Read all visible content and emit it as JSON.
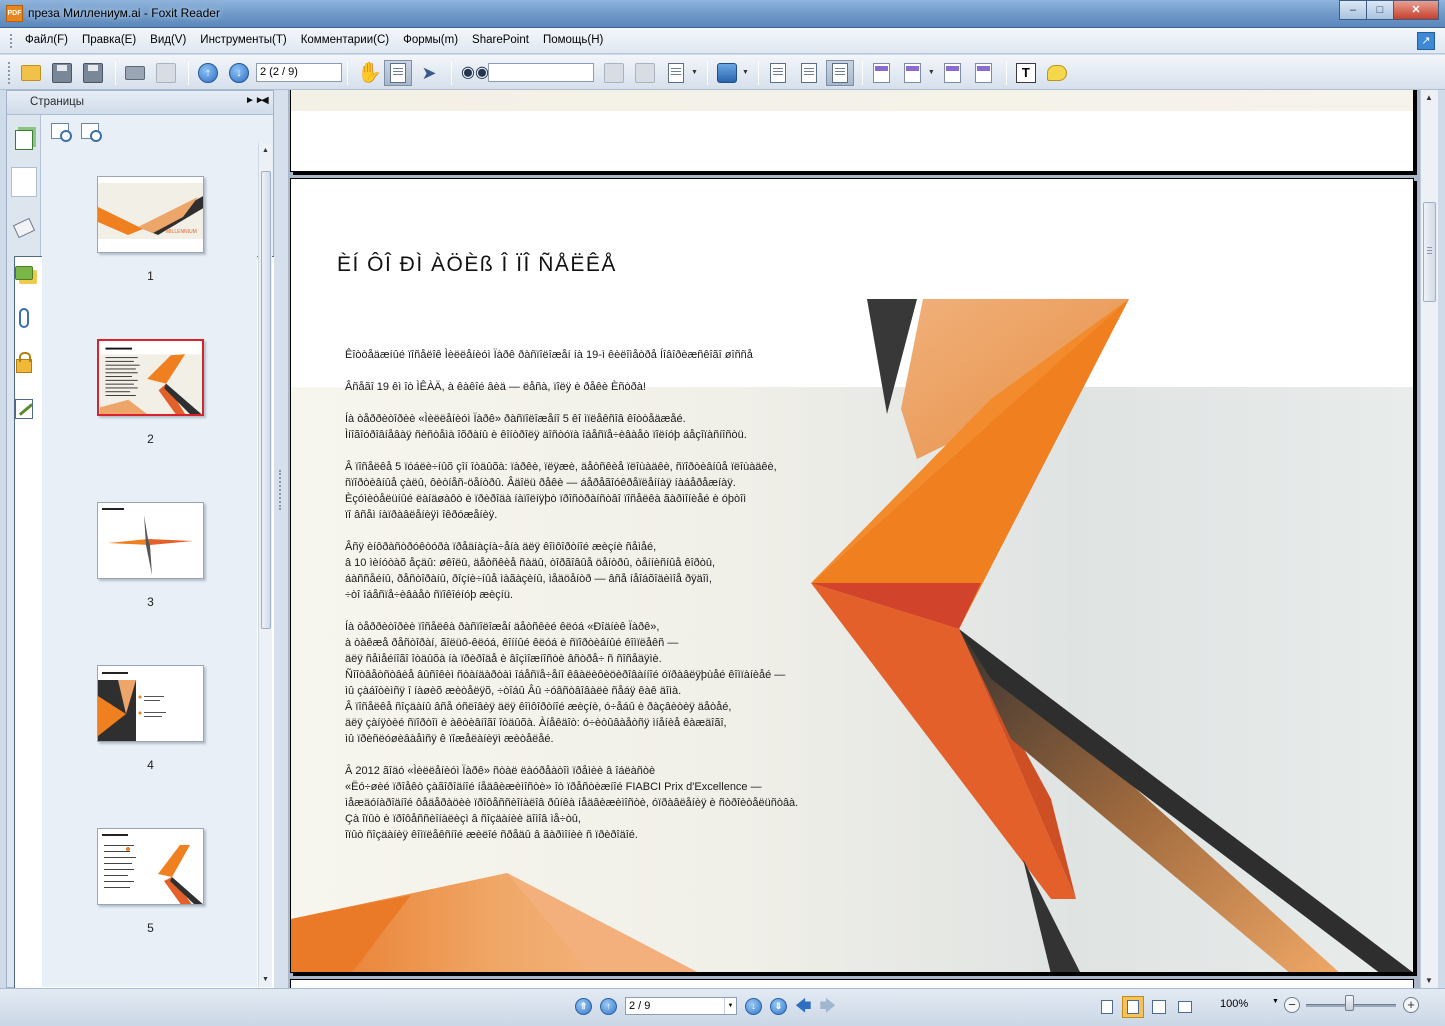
{
  "window": {
    "icon_label": "PDF",
    "title": "преза Миллениум.ai - Foxit Reader",
    "minimize_glyph": "–",
    "maximize_glyph": "□",
    "close_glyph": "✕"
  },
  "menu": {
    "items": [
      "Файл(F)",
      "Правка(E)",
      "Вид(V)",
      "Инструменты(T)",
      "Комментарии(C)",
      "Формы(m)",
      "SharePoint",
      "Помощь(H)"
    ]
  },
  "toolbar": {
    "page_field": "2 (2 / 9)",
    "search_value": ""
  },
  "left_panel": {
    "title": "Страницы",
    "thumbnails": [
      {
        "label": "1",
        "selected": false
      },
      {
        "label": "2",
        "selected": true
      },
      {
        "label": "3",
        "selected": false
      },
      {
        "label": "4",
        "selected": false
      },
      {
        "label": "5",
        "selected": false
      }
    ]
  },
  "document": {
    "page_title": "ÈÍ ÔÎ ÐÌ ÀÖÈß Î  ÏÎ ÑÅËÊÅ",
    "paragraphs": [
      [
        "Êîòòåäæíûé ïîñåëîê Ìèëëåíèóì  Ïàðê ðàñïîëîæåí íà 19-ì êèëîìåòðå Íîâîðèæñêîãî øîññå"
      ],
      [
        "Âñåãî 19 êì  îò  ÌÊÀÄ, à êàêîé âèä — ëåñà, ïîëÿ è ðåêè Èñòðà!"
      ],
      [
        "Íà òåððèòîðèè «Ìèëëåíèóì  Ïàðê» ðàñïîëîæåíî 5 êî  ìïëåêñîâ êîòòåäæåé.",
        "Ìíîãîóðîâíåâàÿ ñèñòåìà îõðàíû è êîíòðîëÿ äîñòóïà îáåñïå÷èâàåò ïîëíóþ áåçîïàñíîñòü."
      ],
      [
        "Â ïîñåëêå 5 ïóáëè÷íûõ çîí îòäûõà: ïàðêè, ïëÿæè, äåòñêèå ïëîùàäêè, ñïîðòèâíûå ïëîùàäêè,",
        "ñïîðòèâíûå çàëû, ôèòíåñ-öåíòðû. Âäîëü ðåêè — áåðåãîóêðåïëåííàÿ íàáåðåæíàÿ.",
        "Èçóìèòåëüíûé ëàíäøàôò è ïðèðîäà íàïîëíÿþò ïðîñòðàíñòâî ïîñåëêà ãàðìîíèåé è óþòîì",
        "ïî âñåì íàïðàâëåíèÿì îêðóæåíèÿ."
      ],
      [
        "Âñÿ èíôðàñòðóêòóðà ïðåäíàçíà÷åíà äëÿ êîìôîðòíîé æèçíè ñåìåé,",
        "â 10 ìèíóòàõ åçäû: øêîëû, äåòñêèå ñàäû, òîðãîâûå öåíòðû, òåííèñíûå êîðòû,",
        "áàññåéíû, ðåñòîðàíû, ðîçíè÷íûå ìàãàçèíû, ìåäöåíòð — âñå íåîáõîäèìîå ðÿäîì,",
        "÷òî îáåñïå÷èâàåò ñïîêîéíóþ æèçíü."
      ],
      [
        "Íà òåððèòîðèè ïîñåëêà ðàñïîëîæåí äåòñêèé êëóá «Ðîäíèê Ïàðê»,",
        "à òàêæå ðåñòîðàí, ãîëüô-êëóá, êîííûé êëóá è ñïîðòèâíûé êîìïëåêñ —",
        "äëÿ ñåìåéíîãî îòäûõà íà ïðèðîäå è âîçìîæíîñòè âñòðå÷ ñ ñîñåäÿìè.",
        "Ñîîòâåòñòâèå âûñîêèì ñòàíäàðòàì îáåñïå÷åíî êâàëèôèöèðîâàííîé óïðàâëÿþùåé êîìïàíèåé —",
        "ìû çàáîòèìñÿ î íàøèõ æèòåëÿõ, ÷òîáû Âû ÷óâñòâîâàëè ñåáÿ êàê äîìà.",
        "Â ïîñåëêå ñîçäàíû âñå óñëîâèÿ äëÿ êîìôîðòíîé æèçíè, ó÷åáû è ðàçâèòèÿ äåòåé,",
        "äëÿ çàíÿòèé ñïîðòîì è àêòèâíîãî îòäûõà. Àíåêäîò: ó÷èòûâàåòñÿ ìíåíèå êàæäîãî,",
        "ìû ïðèñëóøèâàåìñÿ ê ïîæåëàíèÿì æèòåëåé."
      ],
      [
        "Â 2012 ãîäó «Ìèëëåíèóì  Ïàðê» ñòàë ëàóðåàòîì ïðåìèè â îáëàñòè",
        "«Ëó÷øèé ïðîåêò çàãîðîäíîé íåäâèæèìîñòè» îò ïðåñòèæíîé FIABCI Prix d'Excellence —",
        "ìåæäóíàðîäíîé ôåäåðàöèè ïðîôåññèîíàëîâ ðûíêà íåäâèæèìîñòè, óïðàâëåíèÿ è ñòðîèòåëüñòâà.",
        "Çà îïûò è ïðîôåññèîíàëèçì â ñîçäàíèè äîìîâ ìå÷òû,",
        "îïûò ñîçäàíèÿ êîìïëåêñíîé æèëîé ñðåäû â ãàðìîíèè ñ ïðèðîäîé."
      ]
    ]
  },
  "statusbar": {
    "page_field": "2 / 9",
    "zoom": "100%",
    "zoom_out": "−",
    "zoom_in": "+"
  },
  "colors": {
    "accent_orange": "#f07f1f",
    "dark_orange": "#e4602a",
    "peach": "#eda56a",
    "charcoal": "#2f2f2f",
    "selection_red": "#d8232a"
  }
}
